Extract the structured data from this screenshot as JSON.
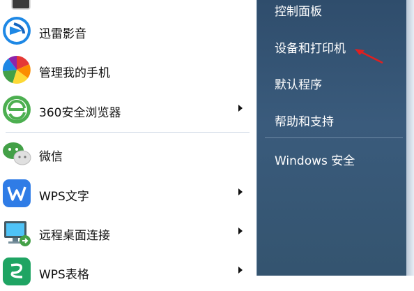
{
  "left_menu": {
    "items": [
      {
        "label": "迅雷影音",
        "icon": "xunlei-player-icon",
        "has_submenu": false
      },
      {
        "label": "管理我的手机",
        "icon": "phone-manager-icon",
        "has_submenu": false
      },
      {
        "label": "360安全浏览器",
        "icon": "browser-360-icon",
        "has_submenu": true
      },
      {
        "label": "微信",
        "icon": "wechat-icon",
        "has_submenu": false
      },
      {
        "label": "WPS文字",
        "icon": "wps-writer-icon",
        "has_submenu": true
      },
      {
        "label": "远程桌面连接",
        "icon": "remote-desktop-icon",
        "has_submenu": true
      },
      {
        "label": "WPS表格",
        "icon": "wps-spreadsheet-icon",
        "has_submenu": true
      }
    ]
  },
  "right_menu": {
    "items": [
      {
        "label": "控制面板"
      },
      {
        "label": "设备和打印机"
      },
      {
        "label": "默认程序"
      },
      {
        "label": "帮助和支持"
      },
      {
        "label": "Windows 安全"
      }
    ]
  },
  "colors": {
    "right_panel": "#34546f",
    "annotation_arrow": "#e02020"
  }
}
